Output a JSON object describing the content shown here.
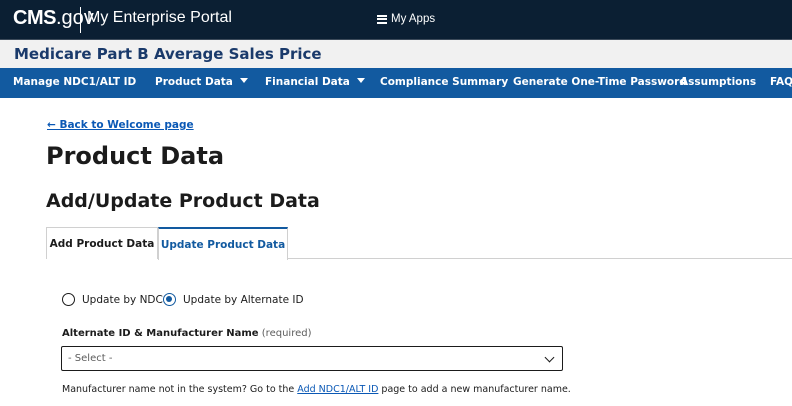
{
  "header": {
    "logo_main": "CMS",
    "logo_suffix": ".gov",
    "portal_title": "My Enterprise Portal",
    "myapps_label": "My Apps",
    "myapps_icon": "list-icon"
  },
  "app": {
    "title": "Medicare Part B Average Sales Price"
  },
  "nav": {
    "items": [
      {
        "label": "Manage NDC1/ALT ID",
        "has_dropdown": false
      },
      {
        "label": "Product Data",
        "has_dropdown": true
      },
      {
        "label": "Financial Data",
        "has_dropdown": true
      },
      {
        "label": "Compliance Summary",
        "has_dropdown": false
      },
      {
        "label": "Generate One-Time Password",
        "has_dropdown": false
      },
      {
        "label": "Assumptions",
        "has_dropdown": false
      },
      {
        "label": "FAQ",
        "has_dropdown": false
      }
    ]
  },
  "page": {
    "back_link": "← Back to Welcome page",
    "title": "Product Data",
    "subtitle": "Add/Update Product Data"
  },
  "tabs": [
    {
      "label": "Add Product Data",
      "active": false
    },
    {
      "label": "Update Product Data",
      "active": true
    }
  ],
  "form": {
    "radio_options": [
      {
        "label": "Update by NDC",
        "checked": false
      },
      {
        "label": "Update by Alternate ID",
        "checked": true
      }
    ],
    "field_label": "Alternate ID & Manufacturer Name",
    "field_required": "(required)",
    "select_value": "- Select -",
    "helper_before": "Manufacturer name not in the system? Go to the ",
    "helper_link": "Add NDC1/ALT ID",
    "helper_after": " page to add a new manufacturer name."
  },
  "colors": {
    "topbar": "#0b1f33",
    "nav": "#125aa0",
    "app_title": "#1a3a6b",
    "link": "#0a58b5"
  }
}
